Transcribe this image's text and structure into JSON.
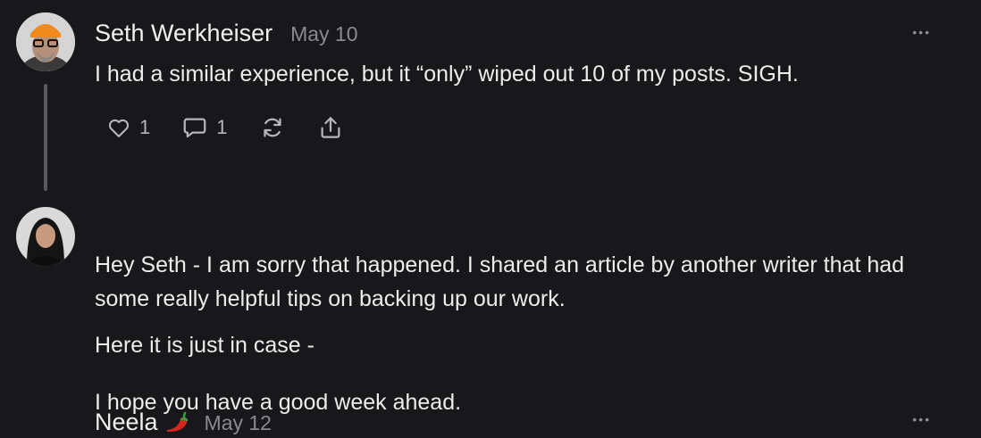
{
  "comments": [
    {
      "author": "Seth Werkheiser",
      "date": "May 10",
      "more": "•••",
      "body": [
        "I had a similar experience, but it “only” wiped out 10 of my posts. SIGH."
      ],
      "actions": {
        "likes": "1",
        "replies": "1"
      }
    },
    {
      "author": "Neela",
      "date": "May 12",
      "more": "•••",
      "body": [
        "Hey Seth - I am sorry that happened. I shared an article by another writer that had some really helpful tips on backing up our work.",
        "Here it is just in case -",
        "I hope you have a good week ahead."
      ]
    }
  ],
  "colors": {
    "background": "#18181a",
    "text": "#ececec",
    "muted": "#8a8a8e",
    "pepper": "#d7261e"
  },
  "icons": [
    "heart-icon",
    "comment-icon",
    "restack-icon",
    "share-icon",
    "chili-pepper-icon",
    "more-icon"
  ]
}
